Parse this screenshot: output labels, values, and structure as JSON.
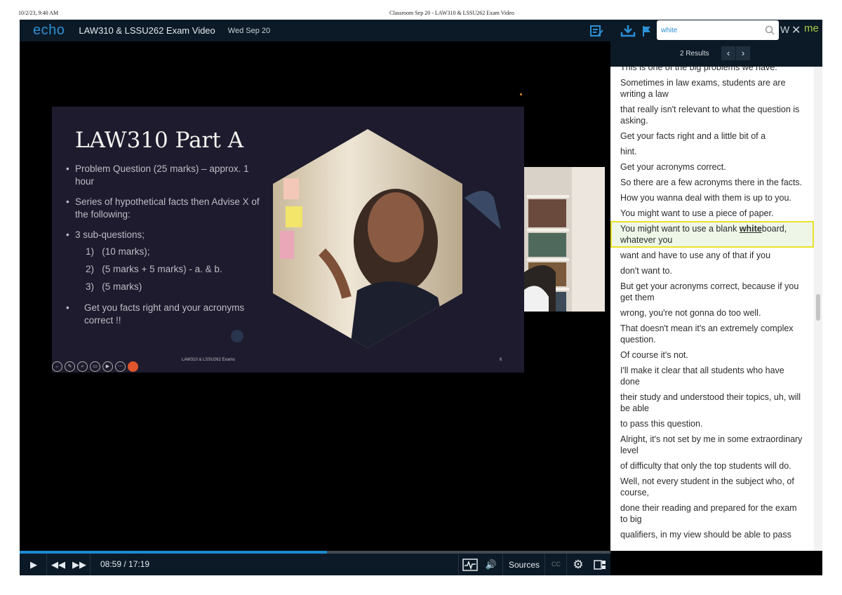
{
  "print_header": {
    "datetime": "10/2/23, 9:40 AM",
    "page_title": "Classroom Sep 20 - LAW310 & LSSU262 Exam Video"
  },
  "topbar": {
    "logo": "echo",
    "course_title": "LAW310 & LSSU262 Exam Video",
    "date": "Wed Sep 20",
    "partial_label": "W",
    "brand_fragment": "me"
  },
  "search": {
    "query": "white",
    "results_label": "2 Results"
  },
  "transcript": {
    "lines": [
      "This is one of the big problems we have.",
      "Sometimes in law exams, students are are writing a law",
      "that really isn't relevant to what the question is asking.",
      "Get your facts right and a little bit of a",
      "hint.",
      "Get your acronyms correct.",
      "So there are a few acronyms there in the facts.",
      "How you wanna deal with them is up to you.",
      "You might want to use a piece of paper."
    ],
    "highlight": {
      "before": "You might want to use a blank ",
      "match": "white",
      "after": "board, whatever you"
    },
    "lines_after": [
      "want and have to use any of that if you",
      "don't want to.",
      "But get your acronyms correct, because if you get them",
      "wrong, you're not gonna do too well.",
      "That doesn't mean it's an extremely complex question.",
      "Of course it's not.",
      "I'll make it clear that all students who have done",
      "their study and understood their topics, uh, will be able",
      "to pass this question.",
      "Alright, it's not set by me in some extraordinary level",
      "of difficulty that only the top students will do.",
      "Well, not every student in the subject who, of course,",
      "done their reading and prepared for the exam to big",
      "qualifiers, in my view should be able to pass"
    ]
  },
  "slide": {
    "title": "LAW310 Part A",
    "bullet1": "Problem Question (25 marks) – approx. 1 hour",
    "bullet2": "Series of hypothetical facts then Advise X of the following:",
    "bullet3": "3 sub-questions;",
    "sub1_num": "1)",
    "sub1": "(10 marks);",
    "sub2_num": "2)",
    "sub2": "(5 marks + 5 marks) - a. & b.",
    "sub3_num": "3)",
    "sub3": "(5 marks)",
    "bullet4": "Get you facts right and your acronyms correct !!",
    "footer": "LAW310 & LSSU262 Exams",
    "page_number": "6"
  },
  "player": {
    "time": "08:59 / 17:19",
    "progress": 0.52,
    "sources_label": "Sources",
    "cc_label": "CC"
  },
  "colors": {
    "accent": "#1d8ad0",
    "highlight_border": "#e8e22a",
    "bar_bg": "#0b1a26"
  }
}
